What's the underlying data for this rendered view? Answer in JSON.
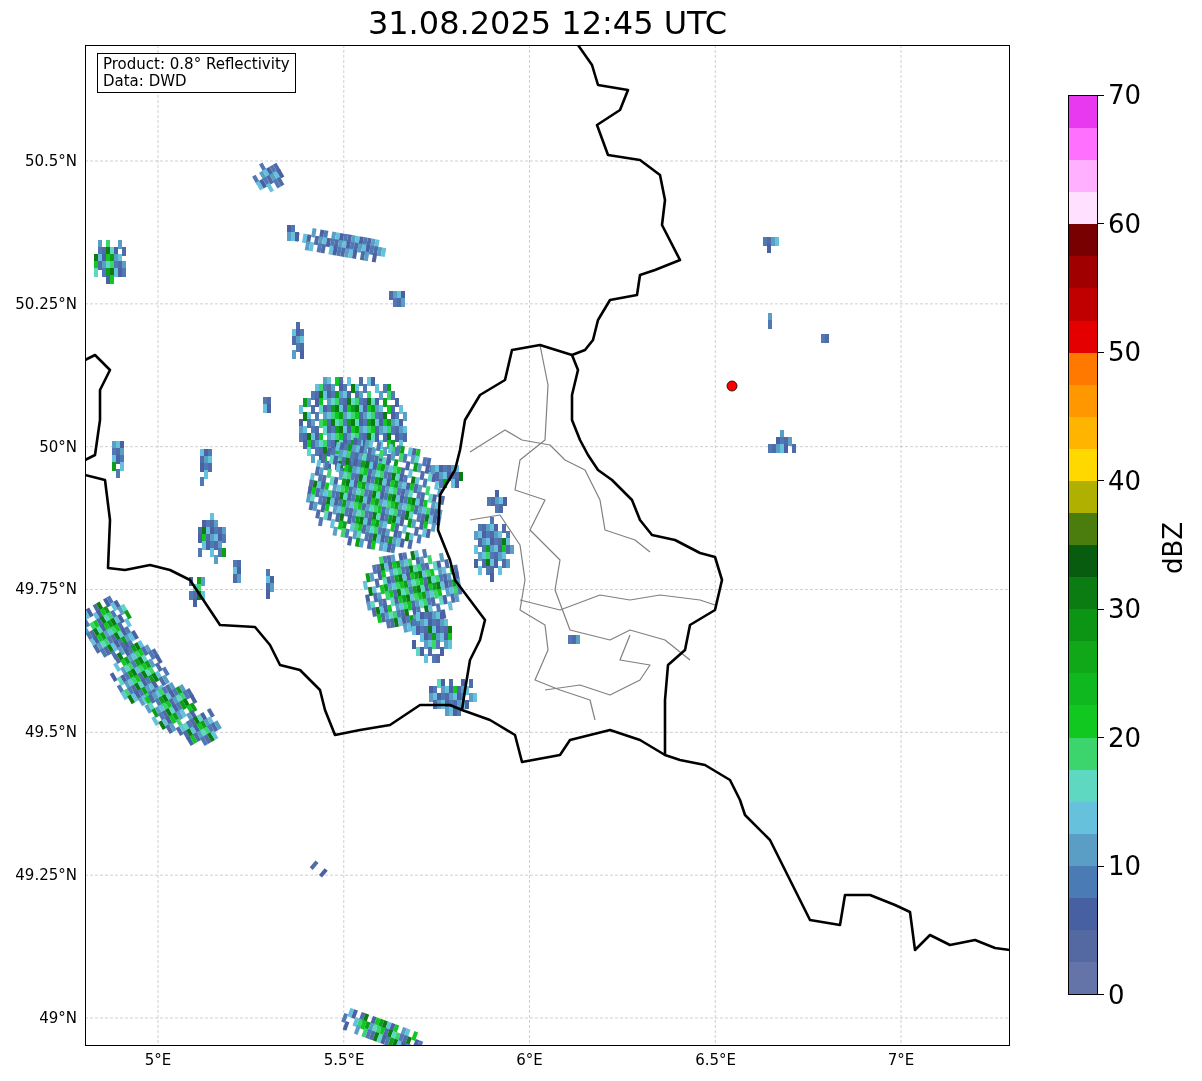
{
  "title": "31.08.2025 12:45 UTC",
  "map": {
    "annotation": [
      "Product: 0.8° Reflectivity",
      "Data: DWD"
    ],
    "y_ticks": [
      "50.5°N",
      "50.25°N",
      "50°N",
      "49.75°N",
      "49.5°N",
      "49.25°N",
      "49°N"
    ],
    "x_ticks": [
      "5°E",
      "5.5°E",
      "6°E",
      "6.5°E",
      "7°E"
    ]
  },
  "colorbar": {
    "label": "dBZ",
    "ticks": [
      "70",
      "60",
      "50",
      "40",
      "30",
      "20",
      "10",
      "0"
    ],
    "bands": [
      {
        "color": "#e838f0"
      },
      {
        "color": "#ff70ff"
      },
      {
        "color": "#ffb0ff"
      },
      {
        "color": "#ffe0ff"
      },
      {
        "color": "#780000"
      },
      {
        "color": "#a00000"
      },
      {
        "color": "#c00000"
      },
      {
        "color": "#e40000"
      },
      {
        "color": "#ff7800"
      },
      {
        "color": "#ff9800"
      },
      {
        "color": "#ffb400"
      },
      {
        "color": "#ffd800"
      },
      {
        "color": "#b0b000"
      },
      {
        "color": "#4a7c0e"
      },
      {
        "color": "#085c10"
      },
      {
        "color": "#0a7c12"
      },
      {
        "color": "#0c9414"
      },
      {
        "color": "#10a818"
      },
      {
        "color": "#10b820"
      },
      {
        "color": "#10c820"
      },
      {
        "color": "#3cd46c"
      },
      {
        "color": "#5fd8c2"
      },
      {
        "color": "#66c2dc"
      },
      {
        "color": "#5a9ec6"
      },
      {
        "color": "#4a7bb4"
      },
      {
        "color": "#4660a2"
      },
      {
        "color": "#5468a2"
      },
      {
        "color": "#6473a8"
      }
    ]
  }
}
